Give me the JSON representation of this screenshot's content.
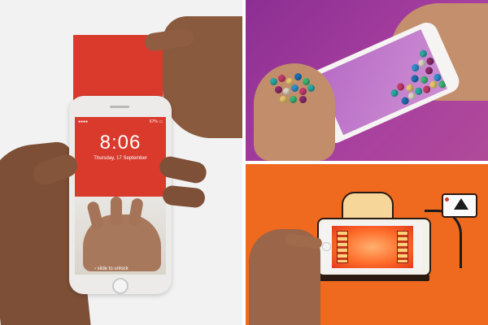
{
  "left_panel": {
    "lock_screen": {
      "carrier": "●●●● ",
      "battery": "67% ▭",
      "time": "8:06",
      "date": "Thursday, 17 September",
      "unlock_hint": "› slide to unlock"
    },
    "colors": {
      "card": "#d93a2c",
      "background": "#f2f2f2"
    }
  },
  "top_right_panel": {
    "colors": {
      "background": "#9a3a9a",
      "screen": "#c07bcb"
    },
    "bead_colors": [
      "#2aa7a0",
      "#1d6fb0",
      "#c23b6a",
      "#e3c46a",
      "#3bb273",
      "#8b2b68",
      "#d9d2c4",
      "#2f8fc8"
    ]
  },
  "bottom_right_panel": {
    "colors": {
      "background": "#ef6a1e",
      "toast": "#f7d69a",
      "screen_glow": "#ff6d2b"
    }
  }
}
